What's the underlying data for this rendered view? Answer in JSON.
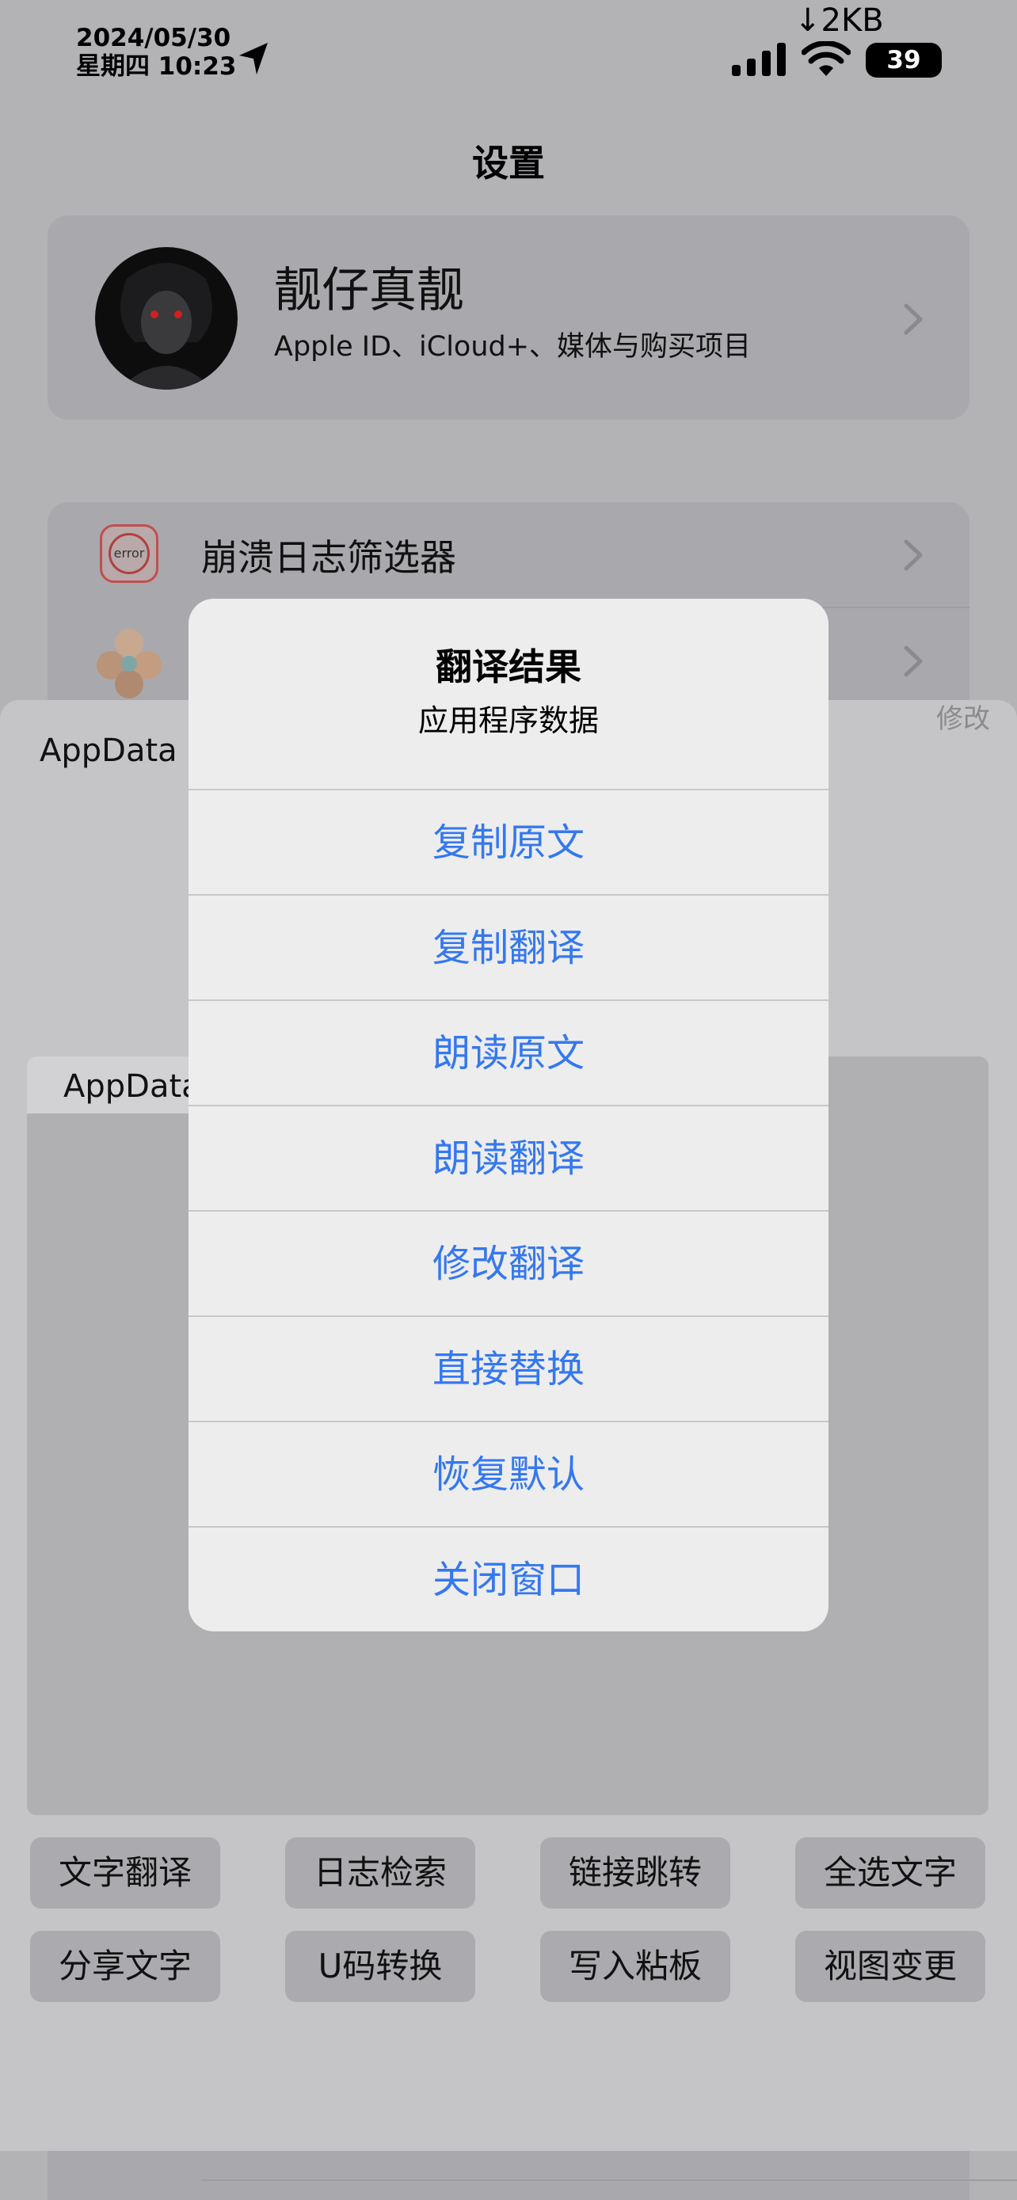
{
  "status_bar": {
    "date": "2024/05/30",
    "weekday_time": "星期四 10:23",
    "network_speed": "↓2KB",
    "battery": "39"
  },
  "page_title": "设置",
  "profile": {
    "name": "靓仔真靓",
    "subtitle": "Apple ID、iCloud+、媒体与购买项目"
  },
  "settings_rows": [
    {
      "label": "崩溃日志筛选器",
      "icon": "error-icon"
    },
    {
      "label": "",
      "icon": "app-icon"
    }
  ],
  "sheet": {
    "edit_label": "修改",
    "title": "AppData",
    "text_label": "AppData"
  },
  "tools": [
    "文字翻译",
    "日志检索",
    "链接跳转",
    "全选文字",
    "分享文字",
    "U码转换",
    "写入粘板",
    "视图变更"
  ],
  "alert": {
    "title": "翻译结果",
    "message": "应用程序数据",
    "actions": [
      "复制原文",
      "复制翻译",
      "朗读原文",
      "朗读翻译",
      "修改翻译",
      "直接替换",
      "恢复默认",
      "关闭窗口"
    ]
  },
  "colors": {
    "accent": "#3478f0",
    "dim_background": "#b3b3b6",
    "alert_bg": "#ededee"
  }
}
